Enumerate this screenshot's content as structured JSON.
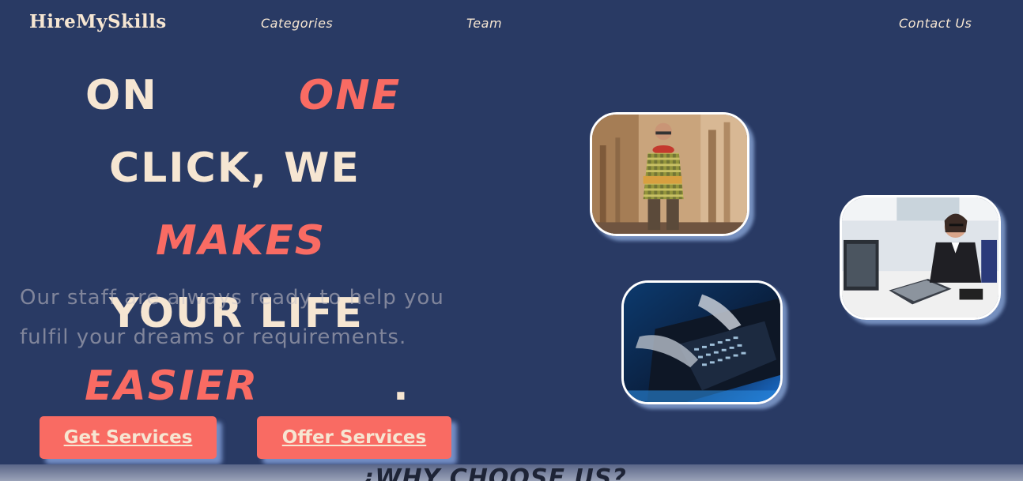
{
  "nav": {
    "brand": "HireMySkills",
    "links": [
      "Categories",
      "Team",
      "Contact Us"
    ]
  },
  "hero": {
    "words": {
      "on": "ON",
      "one": "ONE",
      "click": "CLICK, WE",
      "makes": "MAKES",
      "your_life": "YOUR LIFE",
      "easier": "EASIER",
      "dot": "."
    },
    "tagline": "Our staff are always ready to help you fulfil your dreams or requirements.",
    "buttons": {
      "get_services": "Get Services",
      "offer_services": "Offer Services"
    }
  },
  "images": [
    {
      "name": "carpenter-worker-photo"
    },
    {
      "name": "office-woman-photo"
    },
    {
      "name": "laptop-typing-photo"
    }
  ],
  "section": {
    "title": "¿WHY CHOOSE US?"
  },
  "colors": {
    "background": "#293a64",
    "cream": "#f6e6d2",
    "coral": "#f96b63"
  }
}
